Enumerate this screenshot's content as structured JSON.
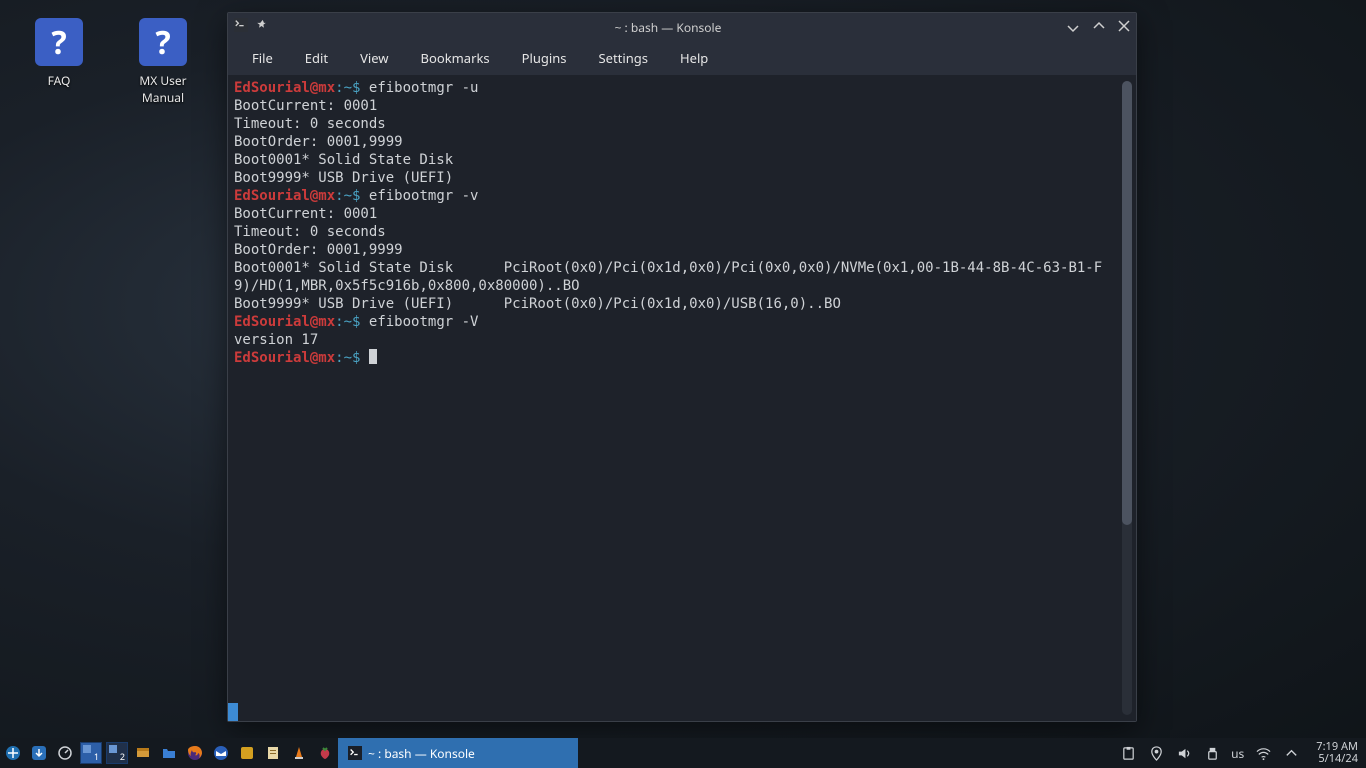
{
  "desktop": {
    "icons": [
      {
        "label": "FAQ"
      },
      {
        "label": "MX User Manual"
      }
    ]
  },
  "window": {
    "title": "~ : bash — Konsole",
    "menu": [
      "File",
      "Edit",
      "View",
      "Bookmarks",
      "Plugins",
      "Settings",
      "Help"
    ]
  },
  "prompt": {
    "user": "EdSourial",
    "at": "@",
    "host": "mx",
    "sep": ":",
    "path": "~",
    "dollar": "$"
  },
  "terminal": {
    "blocks": [
      {
        "cmd": "efibootmgr -u",
        "out": [
          "BootCurrent: 0001",
          "Timeout: 0 seconds",
          "BootOrder: 0001,9999",
          "Boot0001* Solid State Disk",
          "Boot9999* USB Drive (UEFI)"
        ]
      },
      {
        "cmd": "efibootmgr -v",
        "out": [
          "BootCurrent: 0001",
          "Timeout: 0 seconds",
          "BootOrder: 0001,9999",
          "Boot0001* Solid State Disk      PciRoot(0x0)/Pci(0x1d,0x0)/Pci(0x0,0x0)/NVMe(0x1,00-1B-44-8B-4C-63-B1-F9)/HD(1,MBR,0x5f5c916b,0x800,0x80000)..BO",
          "Boot9999* USB Drive (UEFI)      PciRoot(0x0)/Pci(0x1d,0x0)/USB(16,0)..BO"
        ]
      },
      {
        "cmd": "efibootmgr -V",
        "out": [
          "version 17"
        ]
      }
    ]
  },
  "taskbar": {
    "active_task": "~ : bash — Konsole",
    "pager1": "1",
    "pager2": "2",
    "kb_layout": "us",
    "time": "7:19 AM",
    "date": "5/14/24"
  }
}
